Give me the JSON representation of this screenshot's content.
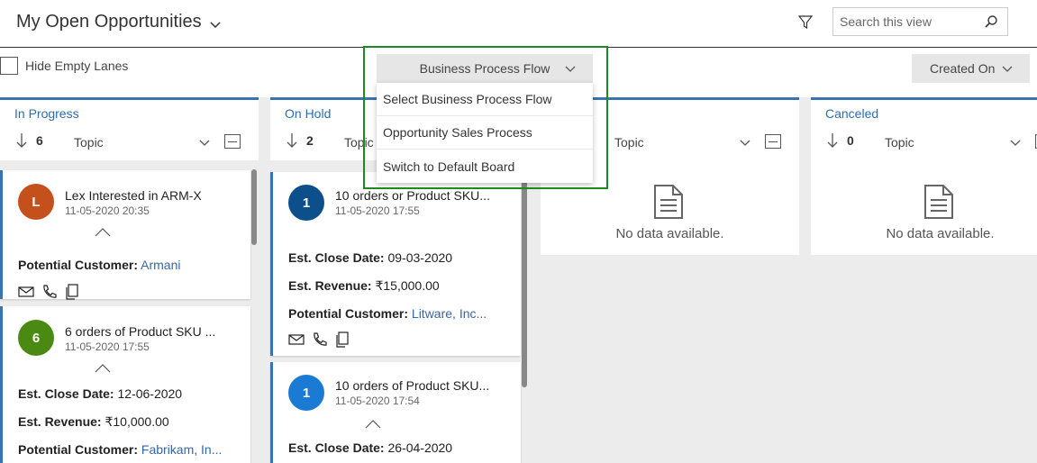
{
  "header": {
    "title": "My Open Opportunities",
    "search_placeholder": "Search this view"
  },
  "toolbar": {
    "hide_empty_lanes": "Hide Empty Lanes",
    "bpf_label": "Business Process Flow",
    "sort_label": "Created On"
  },
  "dropdown": {
    "items": [
      "Select Business Process Flow",
      "Opportunity Sales Process",
      "Switch to Default Board"
    ]
  },
  "lanes": [
    {
      "name": "In Progress",
      "count": "6",
      "sort": "Topic",
      "cards": [
        {
          "initial": "L",
          "color": "#c4501b",
          "title": "Lex Interested in ARM-X",
          "date": "11-05-2020 20:35",
          "customer_label": "Potential Customer:",
          "customer": "Armani"
        },
        {
          "initial": "6",
          "color": "#4b8a12",
          "title": "6 orders of Product SKU ...",
          "date": "11-05-2020 17:55",
          "close_label": "Est. Close Date:",
          "close": "12-06-2020",
          "revenue_label": "Est. Revenue:",
          "revenue": "₹10,000.00",
          "customer_label": "Potential Customer:",
          "customer": "Fabrikam, In..."
        }
      ]
    },
    {
      "name": "On Hold",
      "count": "2",
      "sort": "Topic",
      "cards": [
        {
          "initial": "1",
          "color": "#0d4f8b",
          "title": "10 orders or Product SKU...",
          "date": "11-05-2020 17:55",
          "close_label": "Est. Close Date:",
          "close": "09-03-2020",
          "revenue_label": "Est. Revenue:",
          "revenue": "₹15,000.00",
          "customer_label": "Potential Customer:",
          "customer": "Litware, Inc..."
        },
        {
          "initial": "1",
          "color": "#1a7ad4",
          "title": "10 orders of Product SKU...",
          "date": "11-05-2020 17:54",
          "close_label": "Est. Close Date:",
          "close": "26-04-2020"
        }
      ]
    },
    {
      "name": "",
      "count": "",
      "sort": "Topic",
      "no_data": "No data available."
    },
    {
      "name": "Canceled",
      "count": "0",
      "sort": "Topic",
      "no_data": "No data available."
    }
  ]
}
